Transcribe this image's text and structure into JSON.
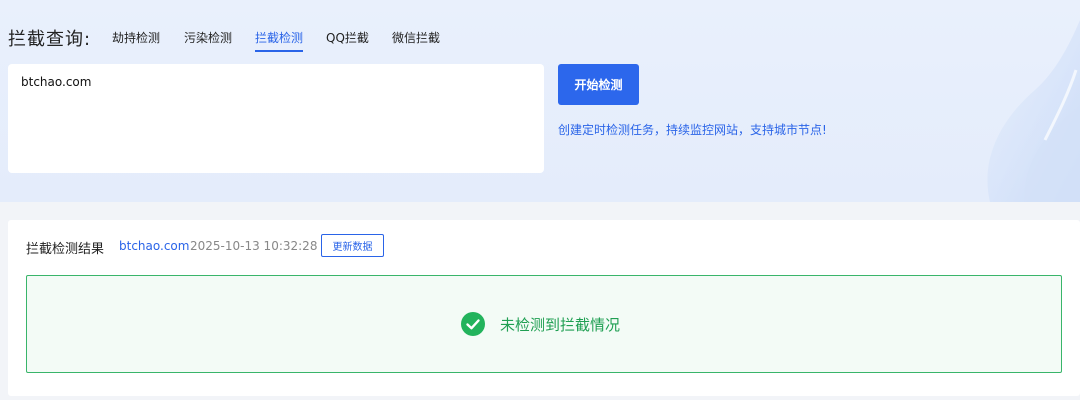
{
  "hero": {
    "title": "拦截查询:",
    "tabs": [
      {
        "label": "劫持检测",
        "active": false
      },
      {
        "label": "污染检测",
        "active": false
      },
      {
        "label": "拦截检测",
        "active": true
      },
      {
        "label": "QQ拦截",
        "active": false
      },
      {
        "label": "微信拦截",
        "active": false
      }
    ],
    "input_value": "btchao.com",
    "start_button": "开始检测",
    "promo_link": "创建定时检测任务，持续监控网站，支持城市节点!"
  },
  "result": {
    "title": "拦截检测结果",
    "domain": "btchao.com",
    "timestamp": "2025-10-13 10:32:28",
    "refresh_button": "更新数据",
    "status_text": "未检测到拦截情况",
    "status_icon": "check-circle-icon"
  },
  "colors": {
    "accent": "#2c67ec",
    "success": "#1f9f52",
    "success_border": "#39b56a",
    "success_bg": "#f3fbf6"
  }
}
